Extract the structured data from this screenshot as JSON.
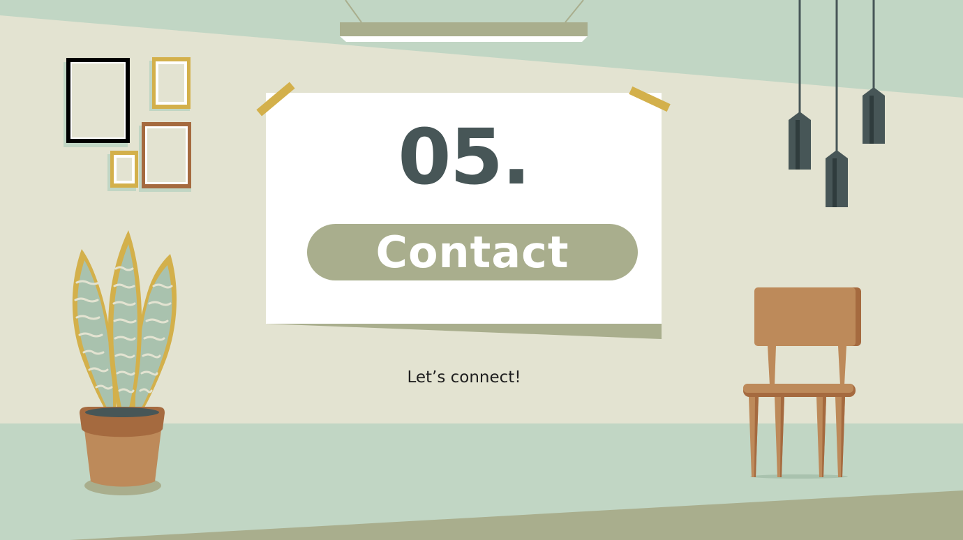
{
  "slide": {
    "section_number": "05.",
    "section_title": "Contact",
    "subtitle": "Let’s connect!"
  },
  "colors": {
    "wall": "#e3e3d1",
    "wall_upper": "#c1d6c4",
    "floor": "#c1d6c4",
    "floor_edge": "#a9ae8d",
    "paper": "#ffffff",
    "tape": "#d3b04b",
    "pill": "#a9ae8d",
    "number_text": "#475657",
    "lamp": "#475657",
    "chair": "#bd8a5a",
    "chair_dark": "#a56a3f",
    "plant_edge": "#d3b04b",
    "plant_leaf": "#a9c2ae",
    "pot": "#bd8a5a"
  },
  "icons": [
    "ceiling-light-icon",
    "picture-frame-icon",
    "pendant-lamp-icon",
    "snake-plant-icon",
    "chair-icon",
    "tape-icon"
  ]
}
